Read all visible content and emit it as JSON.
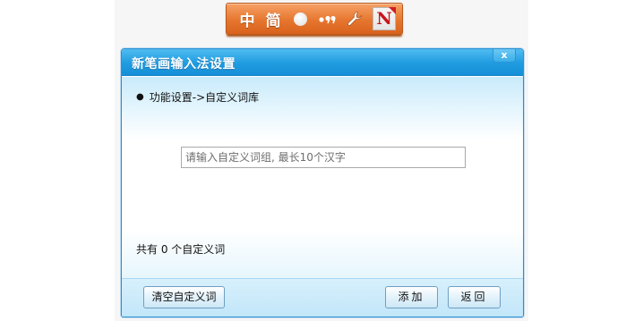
{
  "ime_toolbar": {
    "mode_label": "中",
    "charset_label": "简",
    "width_icon": "full-half-width-circle-icon",
    "punct_label": "•,",
    "settings_icon": "wrench-icon",
    "logo_label": "N"
  },
  "dialog": {
    "title": "新笔画输入法设置",
    "close_label": "x",
    "breadcrumb": "功能设置->自定义词库",
    "input": {
      "value": "",
      "placeholder": "请输入自定义词组, 最长10个汉字"
    },
    "count_text": "共有 0 个自定义词",
    "buttons": {
      "clear": "清空自定义词",
      "add": "添加",
      "back": "返回"
    }
  },
  "colors": {
    "titlebar": "#1f9be0",
    "toolbar": "#e6762f",
    "button_border": "#6f9fc3"
  }
}
